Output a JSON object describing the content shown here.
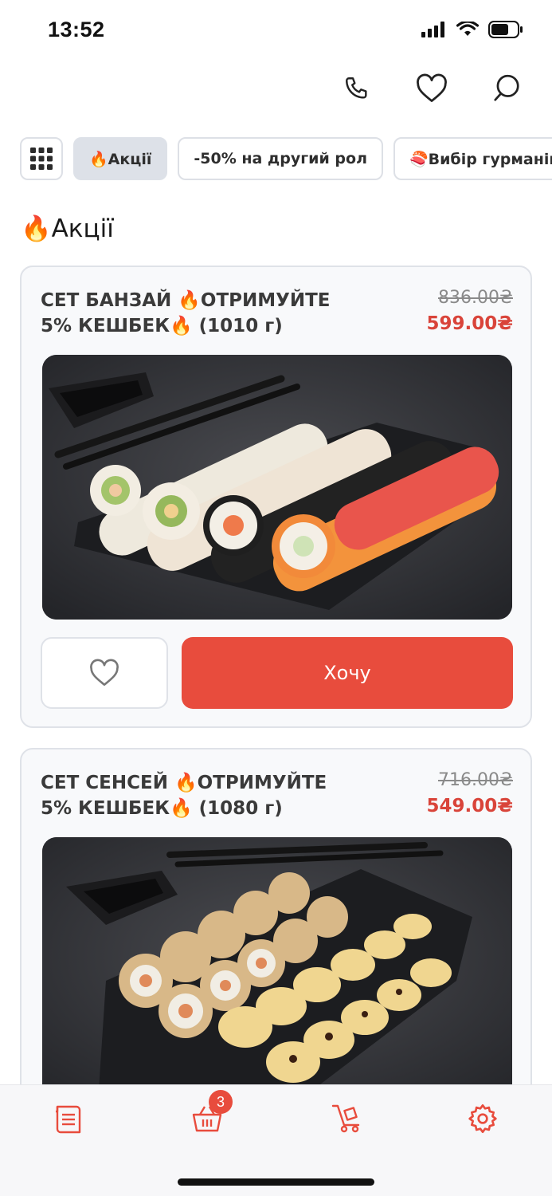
{
  "status_bar": {
    "time": "13:52"
  },
  "header": {
    "icons": [
      "phone-icon",
      "heart-icon",
      "search-icon"
    ]
  },
  "chips": [
    {
      "label": "🔥Акції",
      "active": true
    },
    {
      "label": "-50% на другий рол",
      "active": false
    },
    {
      "label": "🍣Вибір гурманів",
      "active": false
    }
  ],
  "section": {
    "title": "🔥Акції"
  },
  "products": [
    {
      "name": "СЕТ БАНЗАЙ 🔥ОТРИМУЙТЕ 5% КЕШБЕК🔥 (1010 г)",
      "old_price": "836.00₴",
      "price": "599.00₴",
      "button_label": "Хочу"
    },
    {
      "name": "СЕТ СЕНСЕЙ 🔥ОТРИМУЙТЕ 5% КЕШБЕК🔥 (1080 г)",
      "old_price": "716.00₴",
      "price": "549.00₴"
    }
  ],
  "tab_bar": {
    "cart_count": "3",
    "icons": [
      "menu-icon",
      "cart-icon",
      "delivery-icon",
      "settings-icon"
    ]
  },
  "colors": {
    "accent": "#e84c3d",
    "chip_active": "#dde1e8"
  }
}
